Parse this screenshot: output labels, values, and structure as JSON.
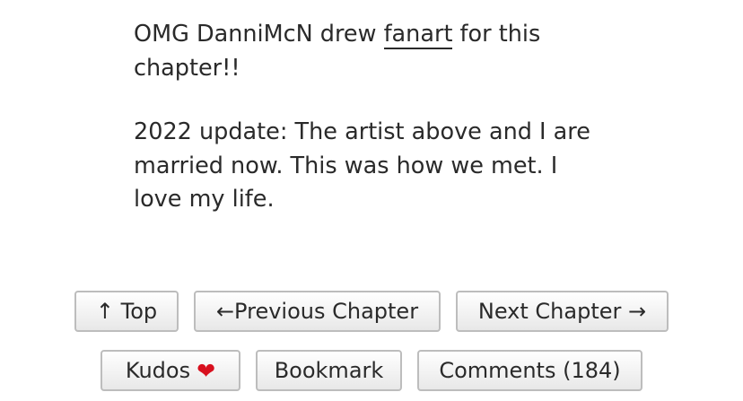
{
  "notes": {
    "line1_before": "OMG DanniMcN drew ",
    "link_text": "fanart",
    "line1_after": " for this chapter!!",
    "paragraph2": "2022 update: The artist above and I are married now. This was how we met. I love my life."
  },
  "nav": {
    "top_label": "↑ Top",
    "prev_label": "←Previous Chapter",
    "next_label": "Next Chapter →"
  },
  "actions": {
    "kudos_label": "Kudos",
    "kudos_icon": "heart-icon",
    "heart_glyph": "❤",
    "heart_color": "#d8101e",
    "bookmark_label": "Bookmark",
    "comments_label": "Comments (184)"
  }
}
